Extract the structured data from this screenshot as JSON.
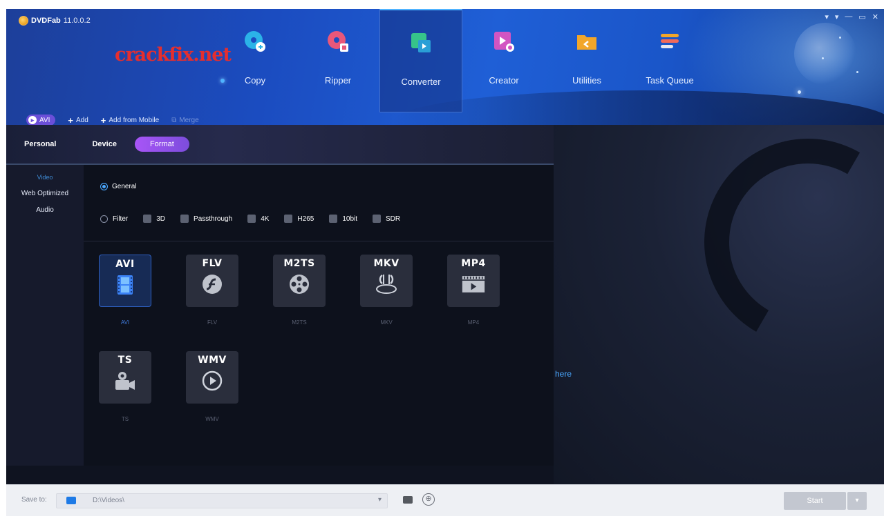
{
  "app": {
    "name": "DVDFab",
    "version": "11.0.0.2",
    "watermark": "crackfix.net",
    "controls": [
      "▾",
      "▾",
      "—",
      "▭",
      "✕"
    ]
  },
  "modules": [
    {
      "label": "Copy",
      "icon": "copy-disc-icon",
      "color": "#2bb3e8"
    },
    {
      "label": "Ripper",
      "icon": "ripper-disc-icon",
      "color": "#e8577a"
    },
    {
      "label": "Converter",
      "icon": "converter-icon",
      "color": "#36c48a"
    },
    {
      "label": "Creator",
      "icon": "creator-icon",
      "color": "#d255c2"
    },
    {
      "label": "Utilities",
      "icon": "utilities-folder-icon",
      "color": "#f2a62a"
    },
    {
      "label": "Task Queue",
      "icon": "task-queue-icon",
      "color": "#f26a5a"
    }
  ],
  "active_module": "Converter",
  "toolbar": {
    "profile": "AVI",
    "add": "Add",
    "add_mobile": "Add from Mobile",
    "merge": "Merge"
  },
  "profile_tabs": [
    "Personal",
    "Device",
    "Format"
  ],
  "active_tab": "Format",
  "sidebar": [
    "Video",
    "Web Optimized",
    "Audio"
  ],
  "options": {
    "general": "General",
    "filter": "Filter",
    "checks": [
      "3D",
      "Passthrough",
      "4K",
      "H265",
      "10bit",
      "SDR"
    ]
  },
  "formats": [
    {
      "title": "AVI",
      "label": "AVI",
      "glyph": "film-strip-icon"
    },
    {
      "title": "FLV",
      "label": "FLV",
      "glyph": "flash-icon"
    },
    {
      "title": "M2TS",
      "label": "M2TS",
      "glyph": "film-reel-icon"
    },
    {
      "title": "MKV",
      "label": "MKV",
      "glyph": "matroska-icon"
    },
    {
      "title": "MP4",
      "label": "MP4",
      "glyph": "play-clapper-icon"
    },
    {
      "title": "TS",
      "label": "TS",
      "glyph": "camera-icon"
    },
    {
      "title": "WMV",
      "label": "WMV",
      "glyph": "play-circle-icon"
    }
  ],
  "selected_format": "AVI",
  "drop_hint": "here",
  "footer": {
    "save_to": "Save to:",
    "path": "D:\\Videos\\",
    "start": "Start"
  }
}
